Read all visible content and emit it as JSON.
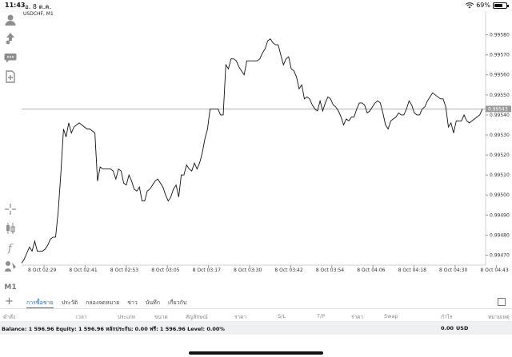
{
  "status": {
    "time": "11:43",
    "date": "อ. 8 ต.ค.",
    "battery": "69%",
    "battery_level": 0.69
  },
  "toolbar": {
    "icons": [
      "account-icon",
      "trade-icon",
      "chat-icon",
      "new-order-icon",
      "crosshair-icon",
      "indicators-icon",
      "function-icon",
      "objects-icon"
    ],
    "timeframe": "M1"
  },
  "chart": {
    "symbol_label": "USDCHF, M1",
    "current_price": "0.99543",
    "y_ticks": [
      "0.99580",
      "0.99570",
      "0.99560",
      "0.99550",
      "0.99540",
      "0.99530",
      "0.99520",
      "0.99510",
      "0.99500",
      "0.99490",
      "0.99480",
      "0.99470"
    ],
    "x_ticks": [
      "8 Oct 02:29",
      "8 Oct 02:41",
      "8 Oct 02:53",
      "8 Oct 03:05",
      "8 Oct 03:17",
      "8 Oct 03:30",
      "8 Oct 03:42",
      "8 Oct 03:54",
      "8 Oct 04:06",
      "8 Oct 04:18",
      "8 Oct 04:30",
      "8 Oct 04:43"
    ]
  },
  "chart_data": {
    "type": "line",
    "title": "USDCHF, M1",
    "ylim": [
      0.99465,
      0.99591
    ],
    "current_price": 0.99543,
    "x": [
      "8 Oct 02:29",
      "8 Oct 02:41",
      "8 Oct 02:53",
      "8 Oct 03:05",
      "8 Oct 03:17",
      "8 Oct 03:30",
      "8 Oct 03:42",
      "8 Oct 03:54",
      "8 Oct 04:06",
      "8 Oct 04:18",
      "8 Oct 04:30",
      "8 Oct 04:43"
    ],
    "series": [
      {
        "values": [
          0.99466,
          0.99468,
          0.99471,
          0.99474,
          0.99472,
          0.99477,
          0.99472,
          0.99472,
          0.99472,
          0.99473,
          0.99475,
          0.99478,
          0.99479,
          0.99479,
          0.99492,
          0.99511,
          0.99533,
          0.99529,
          0.99536,
          0.99531,
          0.99534,
          0.99535,
          0.99536,
          0.99535,
          0.99534,
          0.99533,
          0.99533,
          0.99532,
          0.99531,
          0.99507,
          0.99514,
          0.99513,
          0.99513,
          0.99513,
          0.99513,
          0.99512,
          0.99508,
          0.99513,
          0.99512,
          0.99506,
          0.99505,
          0.9951,
          0.99507,
          0.99503,
          0.99502,
          0.99504,
          0.99497,
          0.99497,
          0.99502,
          0.99503,
          0.99505,
          0.99507,
          0.99508,
          0.99506,
          0.99504,
          0.995,
          0.99497,
          0.99499,
          0.99503,
          0.99505,
          0.99499,
          0.9951,
          0.9951,
          0.99515,
          0.99513,
          0.99512,
          0.99516,
          0.99513,
          0.99516,
          0.99521,
          0.99528,
          0.99533,
          0.99543,
          0.99543,
          0.99543,
          0.99543,
          0.9954,
          0.9954,
          0.99565,
          0.99563,
          0.99568,
          0.99568,
          0.99567,
          0.99564,
          0.99562,
          0.9956,
          0.99567,
          0.99567,
          0.99567,
          0.99567,
          0.99567,
          0.99568,
          0.99571,
          0.99573,
          0.99577,
          0.99578,
          0.99576,
          0.99575,
          0.99575,
          0.9957,
          0.99565,
          0.99568,
          0.99569,
          0.99563,
          0.99562,
          0.99559,
          0.99553,
          0.99555,
          0.99548,
          0.99549,
          0.99548,
          0.99545,
          0.99543,
          0.99542,
          0.99547,
          0.99542,
          0.99546,
          0.99549,
          0.99548,
          0.99545,
          0.99544,
          0.99542,
          0.99539,
          0.99535,
          0.99538,
          0.99537,
          0.99539,
          0.99539,
          0.99543,
          0.99546,
          0.99546,
          0.99545,
          0.99541,
          0.99542,
          0.99544,
          0.99546,
          0.99547,
          0.99546,
          0.99541,
          0.99535,
          0.99533,
          0.99537,
          0.99538,
          0.99539,
          0.99541,
          0.9954,
          0.9954,
          0.99543,
          0.99547,
          0.99545,
          0.99541,
          0.9954,
          0.9954,
          0.99543,
          0.99544,
          0.99547,
          0.99549,
          0.99551,
          0.9955,
          0.99549,
          0.99548,
          0.99548,
          0.99544,
          0.99534,
          0.99536,
          0.99531,
          0.99537,
          0.99537,
          0.99537,
          0.9954,
          0.99537,
          0.99536,
          0.99537,
          0.99538,
          0.99539,
          0.9954,
          0.99543
        ]
      }
    ]
  },
  "tabs": [
    "การซื้อขาย",
    "ประวัติ",
    "กล่องจดหมาย",
    "ข่าว",
    "บันทึก",
    "เกี่ยวกับ"
  ],
  "active_tab": 0,
  "columns": [
    "คำสั่ง",
    "เวลา",
    "ประเภท",
    "ขนาด",
    "สัญลักษณ์",
    "ราคา",
    "S/L",
    "T/P",
    "ราคา",
    "Swap",
    "กำไร",
    "หมายเหตุ"
  ],
  "balance": {
    "text": "Balance: 1 596.96 Equity: 1 596.96 หลักประกัน: 0.00 ฟรี: 1 596.96 Level: 0.00%",
    "profit": "0.00",
    "currency": "USD"
  }
}
